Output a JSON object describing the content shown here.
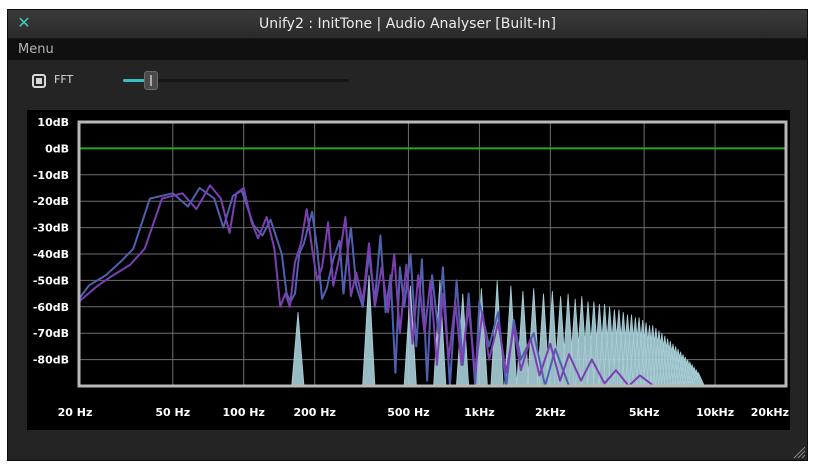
{
  "window": {
    "title": "Unify2 : InitTone | Audio Analyser [Built-In]",
    "close_icon": "close-icon"
  },
  "menu": {
    "items": [
      "Menu"
    ]
  },
  "toolbar": {
    "fft_label": "FFT",
    "fft_checked": true,
    "slider_value": 0.1
  },
  "colors": {
    "accent": "#36c0bf",
    "zero_line": "#22aa22",
    "grid": "#6e6e6e",
    "trace_purple": "#7b3fb2",
    "trace_blue": "#5060b0",
    "trace_light": "#a8cfd8"
  },
  "chart_data": {
    "type": "line",
    "x_scale": "log",
    "xlim": [
      20,
      20000
    ],
    "ylim": [
      -90,
      10
    ],
    "grid": true,
    "x_tick_labels": [
      "20 Hz",
      "50 Hz",
      "100 Hz",
      "200 Hz",
      "500 Hz",
      "1kHz",
      "2kHz",
      "5kHz",
      "10kHz",
      "20kHz"
    ],
    "x_ticks": [
      20,
      50,
      100,
      200,
      500,
      1000,
      2000,
      5000,
      10000,
      20000
    ],
    "y_ticks": [
      10,
      0,
      -10,
      -20,
      -30,
      -40,
      -50,
      -60,
      -70,
      -80
    ],
    "y_tick_labels": [
      "10dB",
      "0dB",
      "-10dB",
      "-20dB",
      "-30dB",
      "-40dB",
      "-50dB",
      "-60dB",
      "-70dB",
      "-80dB"
    ],
    "reference_line_db": 0,
    "spectra": [
      {
        "name": "",
        "color": "#a8cfd8",
        "fill": true,
        "fundamental_hz": 170,
        "harmonic_db": [
          -62,
          -48,
          -52,
          -50,
          -55,
          -53,
          -50,
          -52,
          -54,
          -53,
          -55,
          -54,
          -56,
          -55,
          -57,
          -56,
          -58,
          -58,
          -59,
          -59,
          -60,
          -61,
          -61,
          -62,
          -63,
          -63,
          -64,
          -64,
          -65,
          -66,
          -67,
          -67,
          -68,
          -69,
          -70,
          -71,
          -72,
          -73,
          -74,
          -75,
          -76,
          -77,
          -78,
          -79,
          -80,
          -81,
          -82,
          -83,
          -84,
          -85
        ],
        "floor_db": -90
      },
      {
        "name": "",
        "color": "#5060b0",
        "points": [
          [
            20,
            -57
          ],
          [
            22,
            -52
          ],
          [
            26,
            -48
          ],
          [
            30,
            -43
          ],
          [
            34,
            -38
          ],
          [
            40,
            -19
          ],
          [
            50,
            -17
          ],
          [
            58,
            -22
          ],
          [
            65,
            -15
          ],
          [
            75,
            -19
          ],
          [
            82,
            -30
          ],
          [
            90,
            -18
          ],
          [
            98,
            -16
          ],
          [
            110,
            -29
          ],
          [
            120,
            -33
          ],
          [
            130,
            -27
          ],
          [
            145,
            -40
          ],
          [
            152,
            -55
          ],
          [
            158,
            -58
          ],
          [
            165,
            -55
          ],
          [
            172,
            -40
          ],
          [
            180,
            -36
          ],
          [
            195,
            -24
          ],
          [
            205,
            -38
          ],
          [
            215,
            -57
          ],
          [
            225,
            -53
          ],
          [
            240,
            -42
          ],
          [
            255,
            -35
          ],
          [
            265,
            -55
          ],
          [
            275,
            -40
          ],
          [
            285,
            -30
          ],
          [
            300,
            -52
          ],
          [
            320,
            -60
          ],
          [
            340,
            -40
          ],
          [
            360,
            -58
          ],
          [
            380,
            -33
          ],
          [
            400,
            -62
          ],
          [
            420,
            -48
          ],
          [
            440,
            -85
          ],
          [
            460,
            -45
          ],
          [
            480,
            -60
          ],
          [
            510,
            -40
          ],
          [
            540,
            -75
          ],
          [
            570,
            -42
          ],
          [
            600,
            -88
          ],
          [
            630,
            -48
          ],
          [
            670,
            -70
          ],
          [
            700,
            -45
          ],
          [
            750,
            -90
          ],
          [
            800,
            -50
          ],
          [
            850,
            -82
          ],
          [
            900,
            -55
          ],
          [
            960,
            -90
          ],
          [
            1000,
            -58
          ],
          [
            1100,
            -75
          ],
          [
            1200,
            -62
          ],
          [
            1300,
            -90
          ],
          [
            1400,
            -65
          ],
          [
            1500,
            -80
          ],
          [
            1700,
            -70
          ],
          [
            1900,
            -90
          ],
          [
            2100,
            -76
          ],
          [
            2400,
            -90
          ]
        ]
      },
      {
        "name": "",
        "color": "#7b3fb2",
        "points": [
          [
            20,
            -58
          ],
          [
            24,
            -52
          ],
          [
            28,
            -48
          ],
          [
            33,
            -44
          ],
          [
            38,
            -38
          ],
          [
            45,
            -19
          ],
          [
            55,
            -17
          ],
          [
            63,
            -23
          ],
          [
            72,
            -14
          ],
          [
            80,
            -19
          ],
          [
            87,
            -32
          ],
          [
            93,
            -17
          ],
          [
            100,
            -15
          ],
          [
            108,
            -28
          ],
          [
            115,
            -34
          ],
          [
            125,
            -26
          ],
          [
            135,
            -38
          ],
          [
            143,
            -60
          ],
          [
            150,
            -55
          ],
          [
            157,
            -60
          ],
          [
            165,
            -43
          ],
          [
            175,
            -36
          ],
          [
            185,
            -23
          ],
          [
            195,
            -38
          ],
          [
            205,
            -50
          ],
          [
            215,
            -45
          ],
          [
            228,
            -28
          ],
          [
            240,
            -52
          ],
          [
            255,
            -41
          ],
          [
            270,
            -26
          ],
          [
            285,
            -56
          ],
          [
            300,
            -47
          ],
          [
            320,
            -58
          ],
          [
            340,
            -36
          ],
          [
            360,
            -60
          ],
          [
            385,
            -45
          ],
          [
            410,
            -62
          ],
          [
            435,
            -40
          ],
          [
            460,
            -70
          ],
          [
            490,
            -44
          ],
          [
            520,
            -74
          ],
          [
            550,
            -48
          ],
          [
            585,
            -70
          ],
          [
            620,
            -50
          ],
          [
            660,
            -82
          ],
          [
            700,
            -55
          ],
          [
            740,
            -80
          ],
          [
            790,
            -58
          ],
          [
            840,
            -82
          ],
          [
            900,
            -60
          ],
          [
            960,
            -85
          ],
          [
            1030,
            -62
          ],
          [
            1100,
            -80
          ],
          [
            1200,
            -66
          ],
          [
            1300,
            -85
          ],
          [
            1400,
            -68
          ],
          [
            1500,
            -84
          ],
          [
            1650,
            -72
          ],
          [
            1800,
            -86
          ],
          [
            2000,
            -74
          ],
          [
            2200,
            -88
          ],
          [
            2400,
            -78
          ],
          [
            2700,
            -88
          ],
          [
            3000,
            -80
          ],
          [
            3400,
            -89
          ],
          [
            3800,
            -84
          ],
          [
            4300,
            -90
          ],
          [
            4800,
            -86
          ],
          [
            5500,
            -90
          ]
        ]
      }
    ]
  }
}
